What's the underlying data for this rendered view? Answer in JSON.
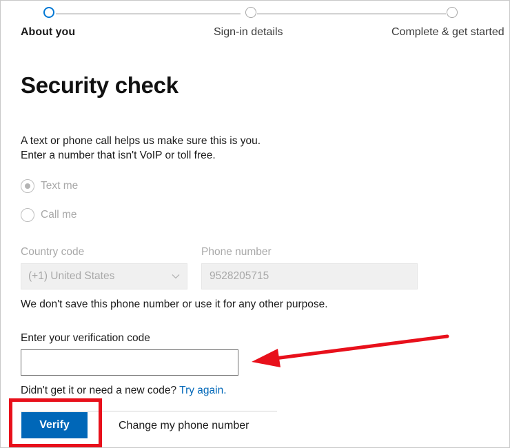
{
  "stepper": {
    "steps": [
      {
        "label": "About you",
        "state": "active"
      },
      {
        "label": "Sign-in details",
        "state": "inactive"
      },
      {
        "label": "Complete & get started",
        "state": "inactive"
      }
    ]
  },
  "main": {
    "title": "Security check",
    "description_line1": "A text or phone call helps us make sure this is you.",
    "description_line2": "Enter a number that isn't VoIP or toll free.",
    "method_options": [
      {
        "label": "Text me",
        "selected": true,
        "disabled": true
      },
      {
        "label": "Call me",
        "selected": false,
        "disabled": true
      }
    ],
    "country_code": {
      "label": "Country code",
      "value": "(+1) United States"
    },
    "phone_number": {
      "label": "Phone number",
      "value": "9528205715"
    },
    "privacy_note": "We don't save this phone number or use it for any other purpose.",
    "verification": {
      "label": "Enter your verification code",
      "value": "",
      "placeholder": ""
    },
    "retry": {
      "text": "Didn't get it or need a new code?",
      "link": "Try again."
    },
    "actions": {
      "verify_label": "Verify",
      "change_label": "Change my phone number"
    }
  },
  "annotations": {
    "arrow_color": "#e8101b",
    "highlight_color": "#e8101b"
  },
  "colors": {
    "accent": "#0067b8",
    "step_active": "#0078d4"
  }
}
